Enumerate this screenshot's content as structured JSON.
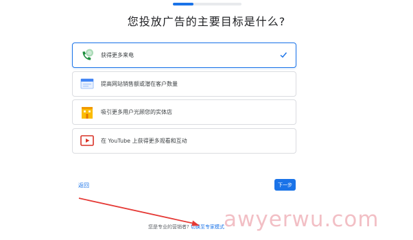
{
  "progress": {
    "value": 0.3
  },
  "title": "您投放广告的主要目标是什么?",
  "options": [
    {
      "label": "获得更多来电",
      "icon": "phone-call-icon",
      "selected": true
    },
    {
      "label": "提高网站销售额或潜在客户数量",
      "icon": "browser-window-icon",
      "selected": false
    },
    {
      "label": "吸引更多用户光顾您的实体店",
      "icon": "storefront-icon",
      "selected": false
    },
    {
      "label": "在 YouTube 上获得更多观看和互动",
      "icon": "youtube-play-icon",
      "selected": false
    }
  ],
  "nav": {
    "back": "返回",
    "next": "下一步"
  },
  "footer": {
    "question": "您是专业的营销者?",
    "switch_link": "切换至专家模式"
  },
  "annotation": {
    "arrow_color": "#e53935"
  },
  "watermark": "awyerwu.com",
  "colors": {
    "accent": "#1a73e8",
    "border": "#dadce0"
  }
}
